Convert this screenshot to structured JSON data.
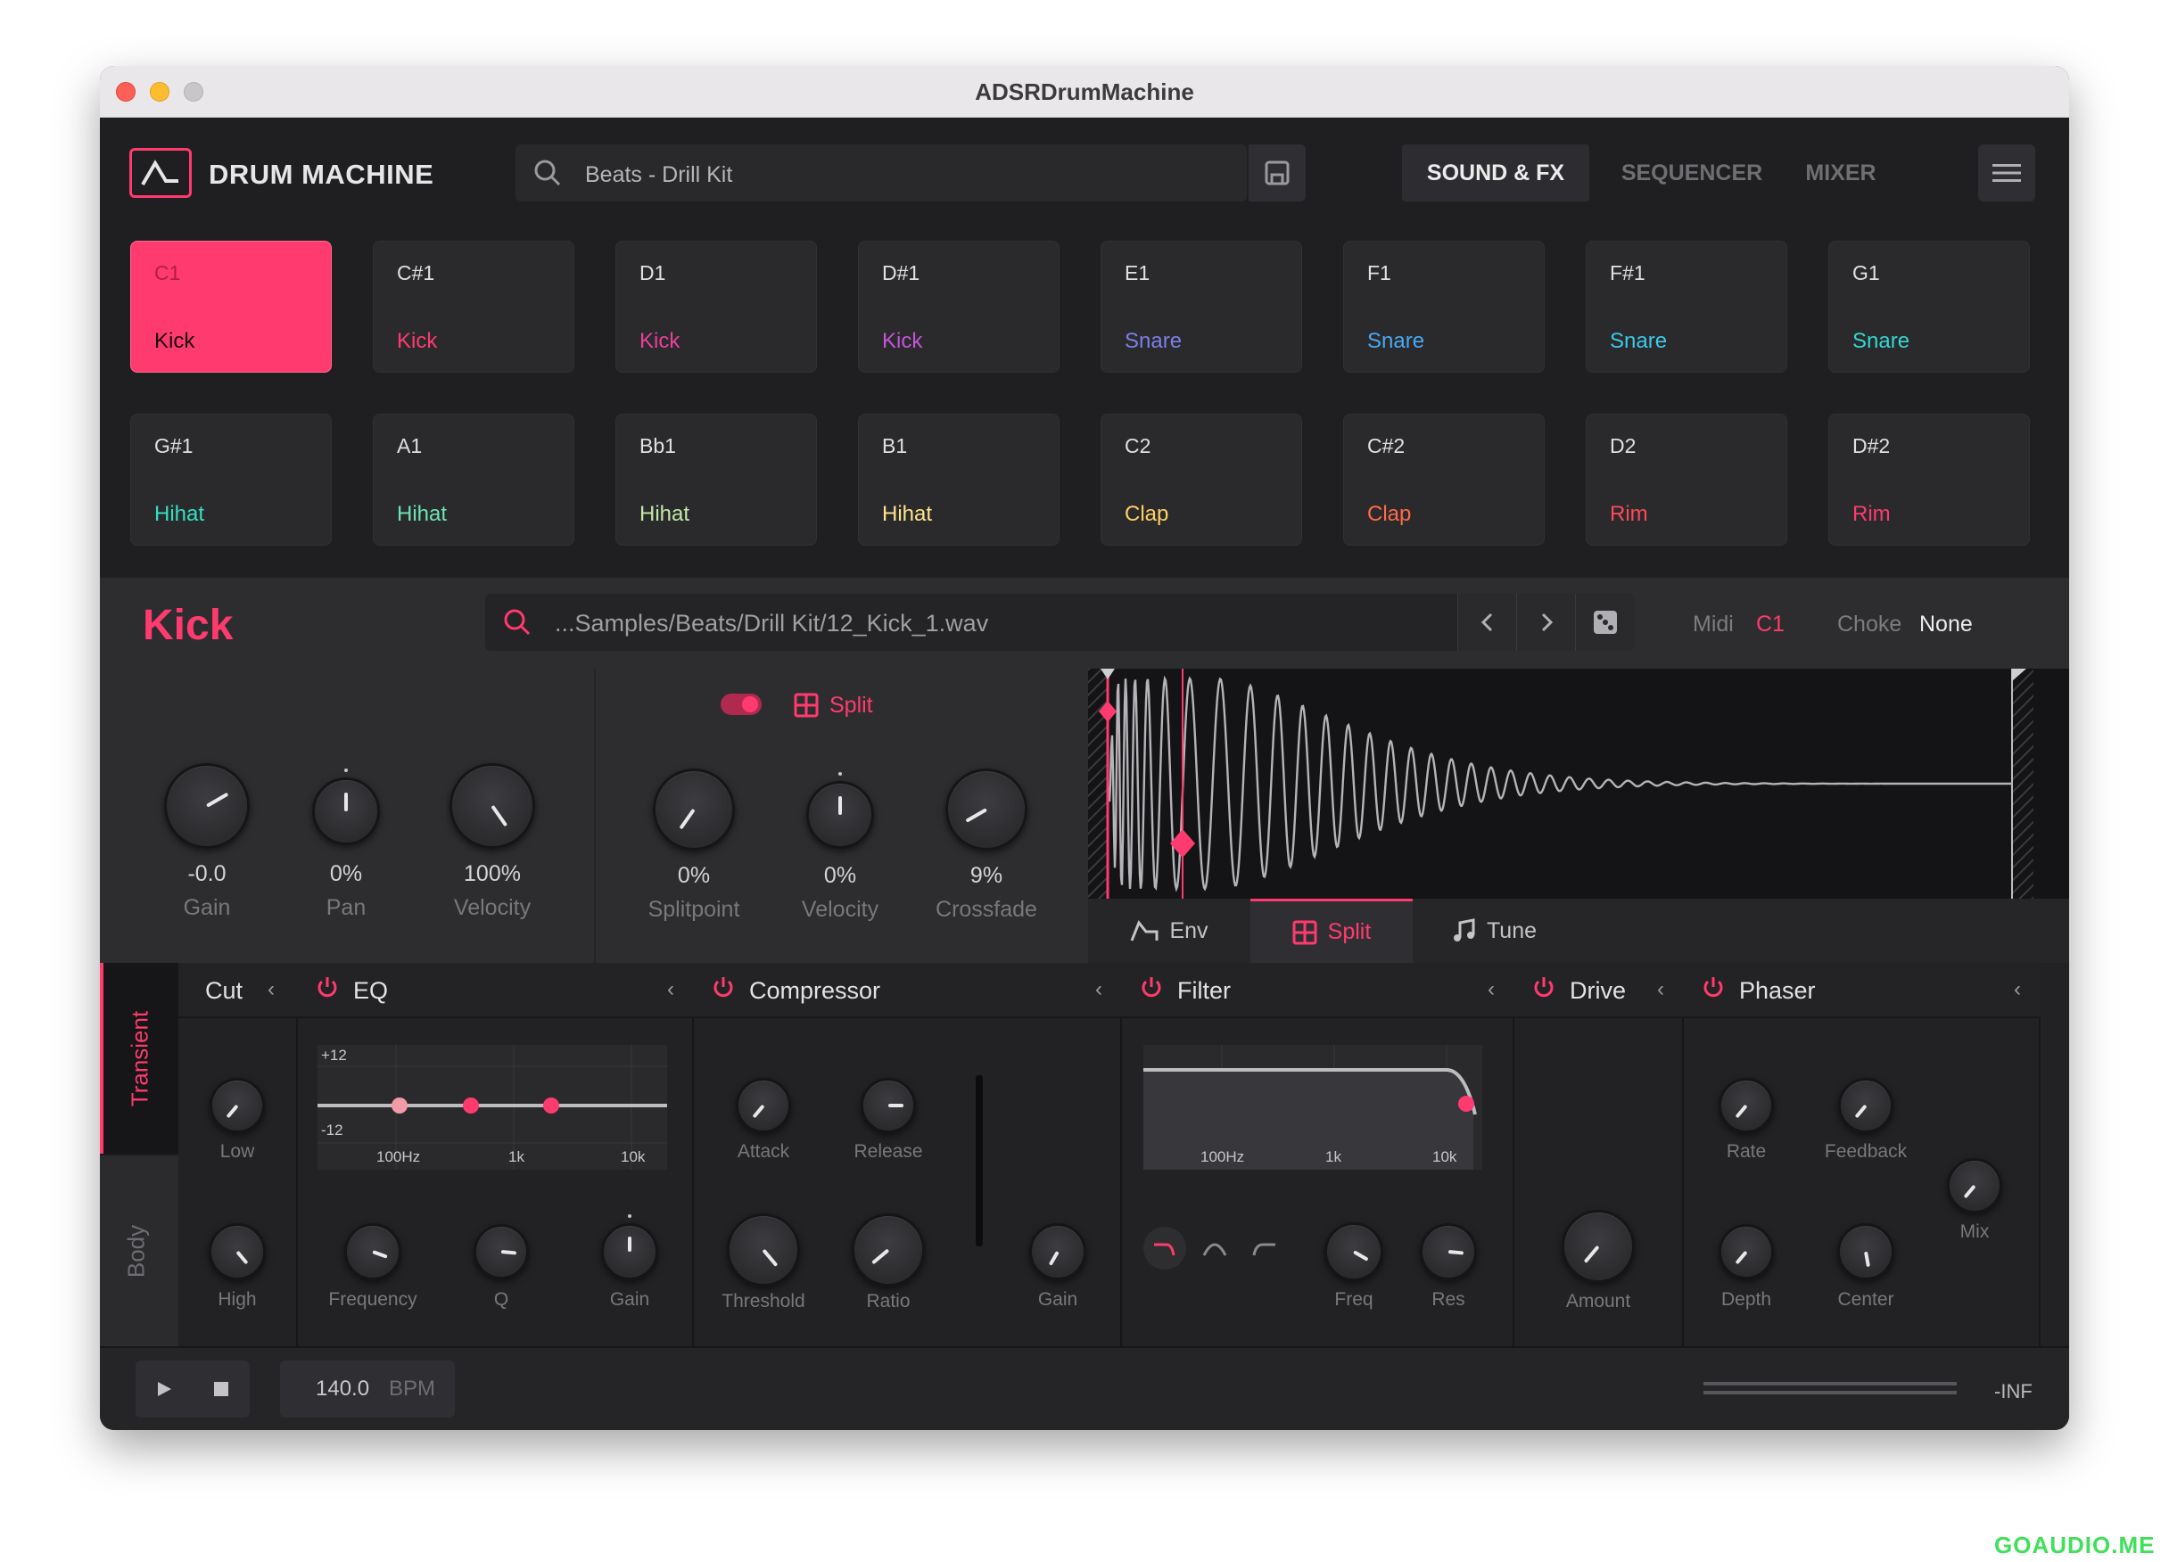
{
  "window": {
    "title": "ADSRDrumMachine"
  },
  "header": {
    "logo_text": "DRUM MACHINE",
    "preset": "Beats - Drill Kit",
    "tabs": [
      "SOUND & FX",
      "SEQUENCER",
      "MIXER"
    ],
    "active_tab": "SOUND & FX"
  },
  "pads": [
    {
      "note": "C1",
      "name": "Kick",
      "color": "#ff3a6e",
      "active": true
    },
    {
      "note": "C#1",
      "name": "Kick",
      "color": "#ff3a6e"
    },
    {
      "note": "D1",
      "name": "Kick",
      "color": "#e8419c"
    },
    {
      "note": "D#1",
      "name": "Kick",
      "color": "#c455d8"
    },
    {
      "note": "E1",
      "name": "Snare",
      "color": "#7d7fe6"
    },
    {
      "note": "F1",
      "name": "Snare",
      "color": "#4aa8f2"
    },
    {
      "note": "F#1",
      "name": "Snare",
      "color": "#3ec8e8"
    },
    {
      "note": "G1",
      "name": "Snare",
      "color": "#32d8d0"
    },
    {
      "note": "G#1",
      "name": "Hihat",
      "color": "#34e0c0"
    },
    {
      "note": "A1",
      "name": "Hihat",
      "color": "#6fe3b6"
    },
    {
      "note": "Bb1",
      "name": "Hihat",
      "color": "#c4e8a8"
    },
    {
      "note": "B1",
      "name": "Hihat",
      "color": "#ffe48a"
    },
    {
      "note": "C2",
      "name": "Clap",
      "color": "#ffd062"
    },
    {
      "note": "C#2",
      "name": "Clap",
      "color": "#ff6a4a"
    },
    {
      "note": "D2",
      "name": "Rim",
      "color": "#ff4a56"
    },
    {
      "note": "D#2",
      "name": "Rim",
      "color": "#ff3a6e"
    }
  ],
  "instrument": {
    "name": "Kick",
    "sample_path": "...Samples/Beats/Drill Kit/12_Kick_1.wav",
    "midi_label": "Midi",
    "midi_value": "C1",
    "choke_label": "Choke",
    "choke_value": "None",
    "main_knobs": [
      {
        "label": "Gain",
        "value": "-0.0"
      },
      {
        "label": "Pan",
        "value": "0%"
      },
      {
        "label": "Velocity",
        "value": "100%"
      }
    ],
    "split_label": "Split",
    "split_knobs": [
      {
        "label": "Splitpoint",
        "value": "0%"
      },
      {
        "label": "Velocity",
        "value": "0%"
      },
      {
        "label": "Crossfade",
        "value": "9%"
      }
    ],
    "wave_tabs": [
      "Env",
      "Split",
      "Tune"
    ],
    "active_wave_tab": "Split"
  },
  "fx": {
    "side_tabs": [
      "Transient",
      "Body"
    ],
    "cut": {
      "title": "Cut",
      "knobs": [
        "Low",
        "High"
      ]
    },
    "eq": {
      "title": "EQ",
      "y_top": "+12",
      "y_bottom": "-12",
      "x_ticks": [
        "100Hz",
        "1k",
        "10k"
      ],
      "knobs": [
        "Frequency",
        "Q",
        "Gain"
      ]
    },
    "compressor": {
      "title": "Compressor",
      "knobs": [
        "Attack",
        "Release",
        "Threshold",
        "Ratio",
        "Gain"
      ]
    },
    "filter": {
      "title": "Filter",
      "x_ticks": [
        "100Hz",
        "1k",
        "10k"
      ],
      "knobs": [
        "Freq",
        "Res"
      ]
    },
    "drive": {
      "title": "Drive",
      "knobs": [
        "Amount"
      ]
    },
    "phaser": {
      "title": "Phaser",
      "knobs": [
        "Rate",
        "Feedback",
        "Depth",
        "Center",
        "Mix"
      ]
    }
  },
  "transport": {
    "bpm_value": "140.0",
    "bpm_label": "BPM",
    "meter_value": "-INF"
  },
  "watermark": "GOAUDIO.ME",
  "colors": {
    "accent": "#ff3a6e",
    "bg": "#1f1f21"
  }
}
